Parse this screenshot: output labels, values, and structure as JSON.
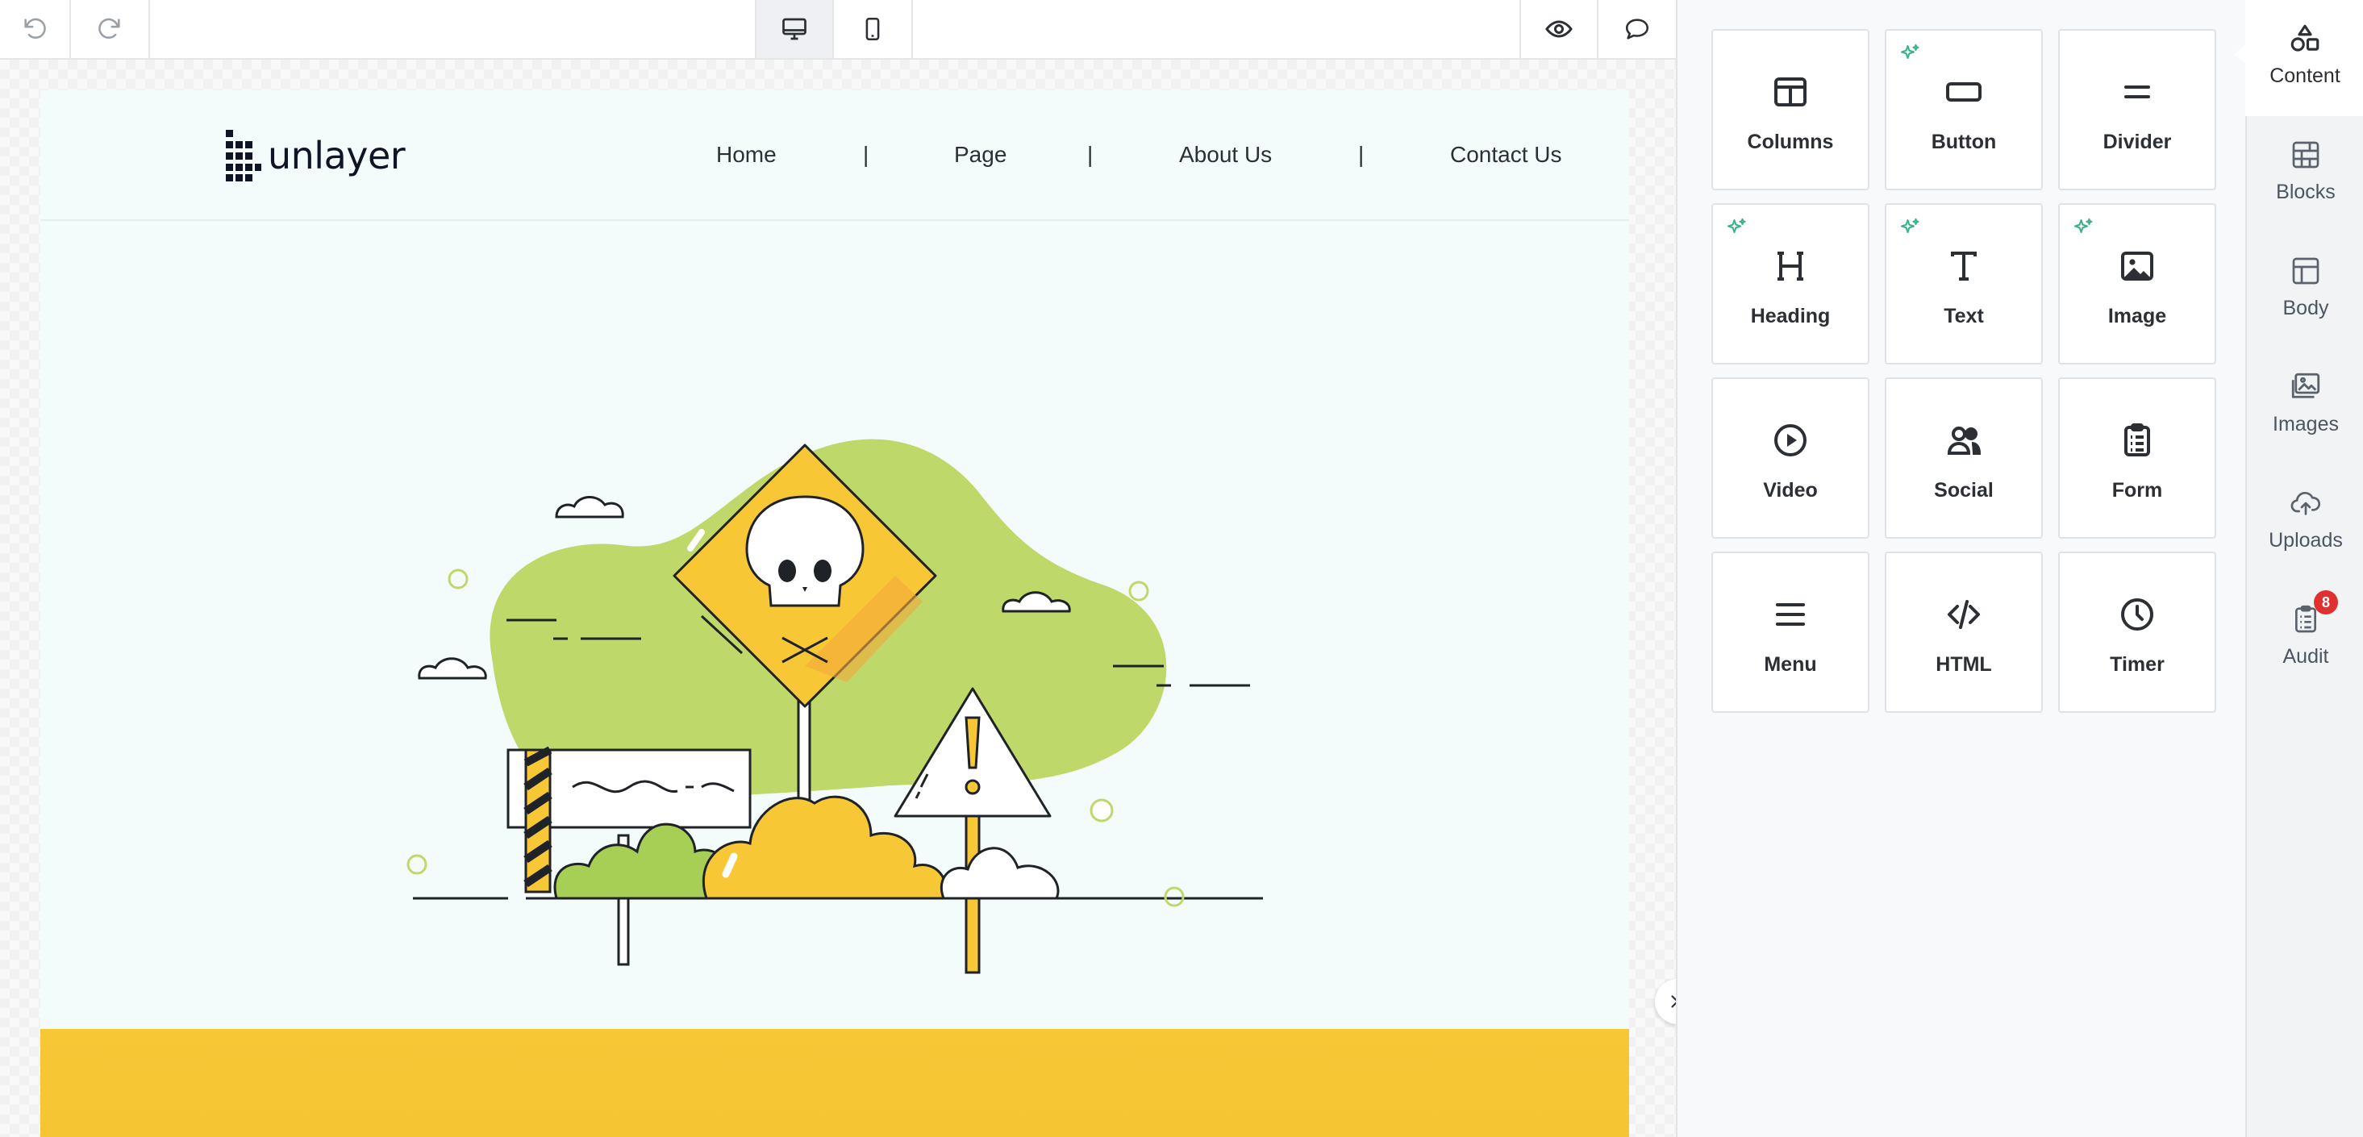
{
  "toolbar": {
    "undo_icon": "undo-icon",
    "redo_icon": "redo-icon",
    "desktop_icon": "desktop-icon",
    "mobile_icon": "mobile-icon",
    "preview_icon": "eye-icon",
    "comments_icon": "comment-icon"
  },
  "email": {
    "logo_text": "unlayer",
    "nav": [
      "Home",
      "Page",
      "About Us",
      "Contact Us"
    ],
    "nav_separator": "|",
    "band_color": "#f7c736",
    "background_color": "#f4fcfb"
  },
  "panel": {
    "tiles": [
      {
        "label": "Columns",
        "icon": "columns-icon",
        "ai": false
      },
      {
        "label": "Button",
        "icon": "button-icon",
        "ai": true
      },
      {
        "label": "Divider",
        "icon": "divider-icon",
        "ai": false
      },
      {
        "label": "Heading",
        "icon": "heading-icon",
        "ai": true
      },
      {
        "label": "Text",
        "icon": "text-icon",
        "ai": true
      },
      {
        "label": "Image",
        "icon": "image-icon",
        "ai": true
      },
      {
        "label": "Video",
        "icon": "video-icon",
        "ai": false
      },
      {
        "label": "Social",
        "icon": "social-icon",
        "ai": false
      },
      {
        "label": "Form",
        "icon": "form-icon",
        "ai": false
      },
      {
        "label": "Menu",
        "icon": "menu-icon",
        "ai": false
      },
      {
        "label": "HTML",
        "icon": "html-icon",
        "ai": false
      },
      {
        "label": "Timer",
        "icon": "timer-icon",
        "ai": false
      }
    ],
    "ai_accent": "#37b38a"
  },
  "tabs": [
    {
      "label": "Content",
      "icon": "shapes-icon",
      "active": true
    },
    {
      "label": "Blocks",
      "icon": "blocks-icon",
      "active": false
    },
    {
      "label": "Body",
      "icon": "body-icon",
      "active": false
    },
    {
      "label": "Images",
      "icon": "images-icon",
      "active": false
    },
    {
      "label": "Uploads",
      "icon": "upload-icon",
      "active": false
    },
    {
      "label": "Audit",
      "icon": "audit-icon",
      "active": false,
      "badge": "8"
    }
  ]
}
